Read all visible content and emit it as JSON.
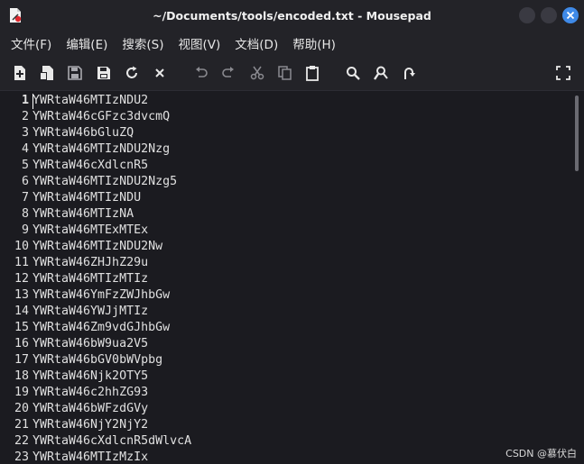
{
  "window": {
    "title": "~/Documents/tools/encoded.txt - Mousepad"
  },
  "menu": [
    {
      "label": "文件(F)"
    },
    {
      "label": "编辑(E)"
    },
    {
      "label": "搜索(S)"
    },
    {
      "label": "视图(V)"
    },
    {
      "label": "文档(D)"
    },
    {
      "label": "帮助(H)"
    }
  ],
  "toolbar": {
    "icons": [
      "new-document-icon",
      "new-window-icon",
      "save-icon",
      "save-as-icon",
      "reload-icon",
      "close-document-icon",
      "undo-icon",
      "redo-icon",
      "cut-icon",
      "copy-icon",
      "paste-icon",
      "find-icon",
      "find-replace-icon",
      "goto-line-icon",
      "fullscreen-icon"
    ]
  },
  "editor": {
    "lines": [
      {
        "n": "1",
        "text": "YWRtaW46MTIzNDU2"
      },
      {
        "n": "2",
        "text": "YWRtaW46cGFzc3dvcmQ"
      },
      {
        "n": "3",
        "text": "YWRtaW46bGluZQ"
      },
      {
        "n": "4",
        "text": "YWRtaW46MTIzNDU2Nzg"
      },
      {
        "n": "5",
        "text": "YWRtaW46cXdlcnR5"
      },
      {
        "n": "6",
        "text": "YWRtaW46MTIzNDU2Nzg5"
      },
      {
        "n": "7",
        "text": "YWRtaW46MTIzNDU"
      },
      {
        "n": "8",
        "text": "YWRtaW46MTIzNA"
      },
      {
        "n": "9",
        "text": "YWRtaW46MTExMTEx"
      },
      {
        "n": "10",
        "text": "YWRtaW46MTIzNDU2Nw"
      },
      {
        "n": "11",
        "text": "YWRtaW46ZHJhZ29u"
      },
      {
        "n": "12",
        "text": "YWRtaW46MTIzMTIz"
      },
      {
        "n": "13",
        "text": "YWRtaW46YmFzZWJhbGw"
      },
      {
        "n": "14",
        "text": "YWRtaW46YWJjMTIz"
      },
      {
        "n": "15",
        "text": "YWRtaW46Zm9vdGJhbGw"
      },
      {
        "n": "16",
        "text": "YWRtaW46bW9ua2V5"
      },
      {
        "n": "17",
        "text": "YWRtaW46bGV0bWVpbg"
      },
      {
        "n": "18",
        "text": "YWRtaW46Njk2OTY5"
      },
      {
        "n": "19",
        "text": "YWRtaW46c2hhZG93"
      },
      {
        "n": "20",
        "text": "YWRtaW46bWFzdGVy"
      },
      {
        "n": "21",
        "text": "YWRtaW46NjY2NjY2"
      },
      {
        "n": "22",
        "text": "YWRtaW46cXdlcnR5dWlvcA"
      },
      {
        "n": "23",
        "text": "YWRtaW46MTIzMzIx"
      }
    ]
  },
  "watermark": "CSDN @慕伏白"
}
